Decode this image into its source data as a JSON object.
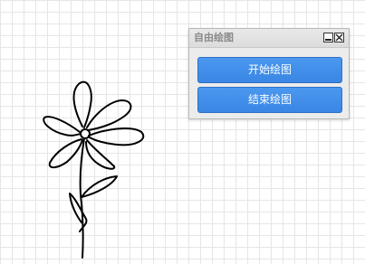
{
  "panel": {
    "title": "自由绘图",
    "minimize_icon": "minimize-icon",
    "close_icon": "close-icon",
    "start_label": "开始绘图",
    "end_label": "结束绘图",
    "accent_color": "#3f8de8"
  },
  "canvas": {
    "grid_color": "#e6e6e6",
    "stroke_color": "#000000"
  }
}
